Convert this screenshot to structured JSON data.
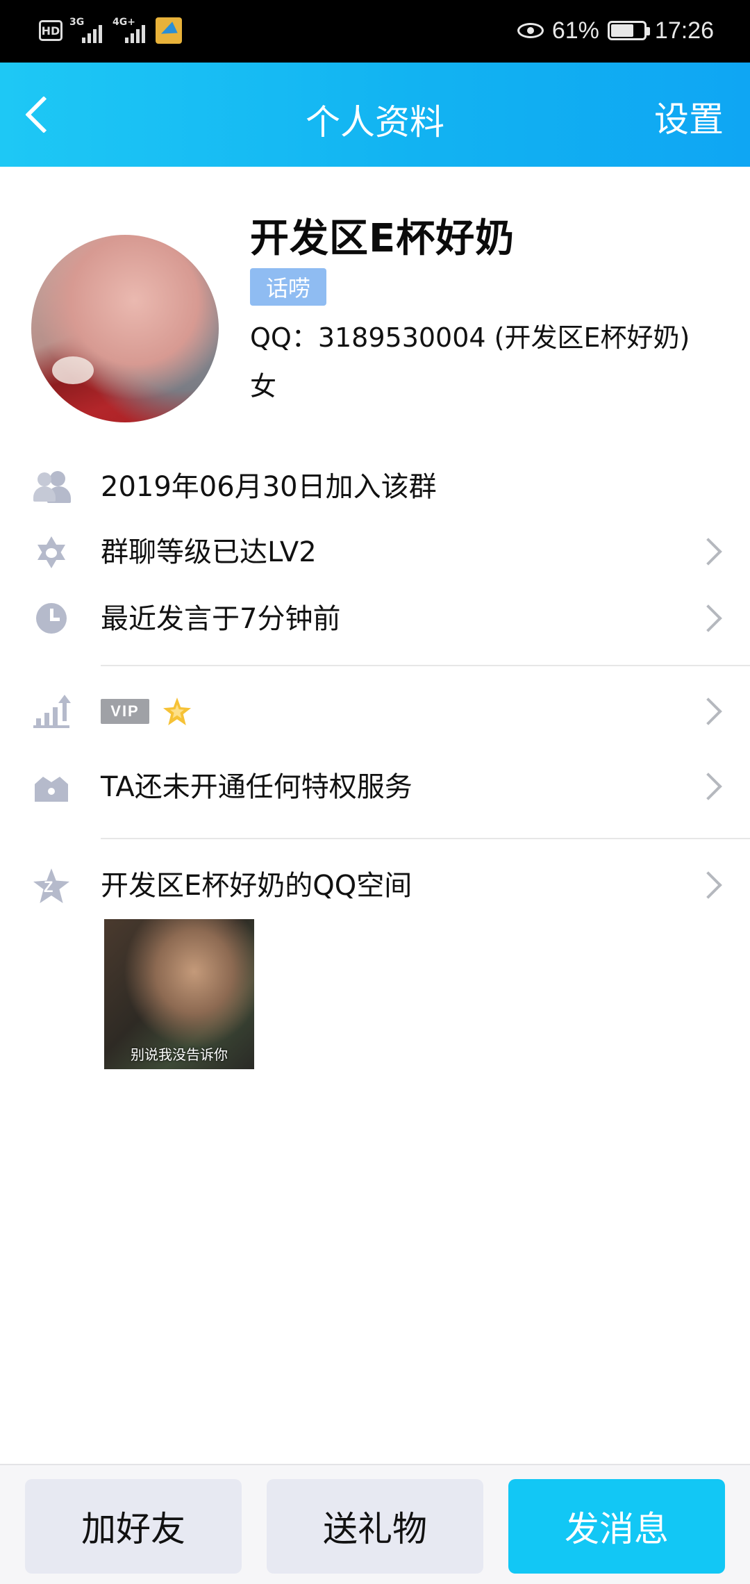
{
  "status_bar": {
    "left_label": "HD",
    "net1": "3G",
    "net2": "4G+",
    "battery_pct": "61%",
    "time": "17:26"
  },
  "header": {
    "title": "个人资料",
    "settings_label": "设置"
  },
  "profile": {
    "name": "开发区E杯好奶",
    "tag": "话唠",
    "qq_line": "QQ：3189530004 (开发区E杯好奶)",
    "gender": "女"
  },
  "info_rows": [
    {
      "icon": "group-members-icon",
      "text": "2019年06月30日加入该群",
      "has_chevron": false
    },
    {
      "icon": "level-star-icon",
      "text": "群聊等级已达LV2",
      "has_chevron": true
    },
    {
      "icon": "clock-icon",
      "text": "最近发言于7分钟前",
      "has_chevron": true
    }
  ],
  "vip": {
    "badge": "VIP",
    "icon": "star-icon"
  },
  "privilege_text": "TA还未开通任何特权服务",
  "qzone": {
    "label": "开发区E杯好奶的QQ空间",
    "photo_caption": "别说我没告诉你"
  },
  "bottom_buttons": {
    "add_friend": "加好友",
    "send_gift": "送礼物",
    "send_message": "发消息"
  },
  "colors": {
    "header_gradient_start": "#1ec8f5",
    "header_gradient_end": "#0fa6f3",
    "primary_button": "#12c7f5",
    "secondary_button": "#e7e9f2",
    "tag_bg": "#8fbcf2",
    "icon_gray": "#b5bacb"
  }
}
